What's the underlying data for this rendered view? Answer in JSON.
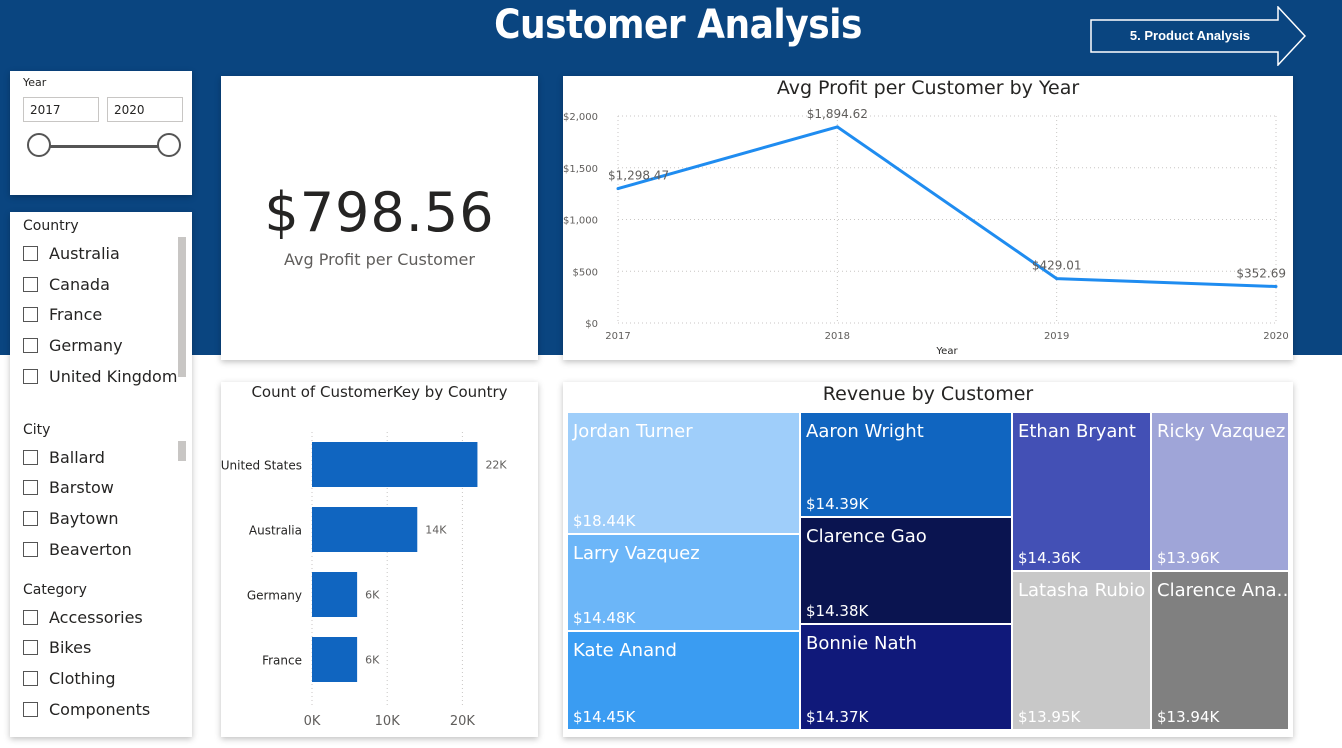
{
  "page": {
    "title": "Customer Analysis"
  },
  "nav_button": {
    "label": "5. Product Analysis"
  },
  "year_slicer": {
    "label": "Year",
    "start": "2017",
    "end": "2020"
  },
  "country_slicer": {
    "title": "Country",
    "items": [
      "Australia",
      "Canada",
      "France",
      "Germany",
      "United Kingdom"
    ]
  },
  "city_slicer": {
    "title": "City",
    "items": [
      "Ballard",
      "Barstow",
      "Baytown",
      "Beaverton"
    ]
  },
  "category_slicer": {
    "title": "Category",
    "items": [
      "Accessories",
      "Bikes",
      "Clothing",
      "Components"
    ]
  },
  "kpi": {
    "value": "$798.56",
    "label": "Avg Profit per Customer"
  },
  "line_chart": {
    "title": "Avg Profit per Customer by Year"
  },
  "bar_chart": {
    "title": "Count of CustomerKey by Country"
  },
  "treemap": {
    "title": "Revenue by Customer"
  },
  "colors": {
    "header": "#0a4580",
    "line": "#1f8cf0",
    "bar": "#1065c0"
  },
  "chart_data": [
    {
      "type": "line",
      "title": "Avg Profit per Customer by Year",
      "xlabel": "Year",
      "ylabel": "",
      "x": [
        "2017",
        "2018",
        "2019",
        "2020"
      ],
      "values": [
        1298.47,
        1894.62,
        429.01,
        352.69
      ],
      "data_labels": [
        "$1,298.47",
        "$1,894.62",
        "$429.01",
        "$352.69"
      ],
      "ylim": [
        0,
        2000
      ],
      "yticks": [
        "$0",
        "$500",
        "$1,000",
        "$1,500",
        "$2,000"
      ],
      "grid": true
    },
    {
      "type": "bar",
      "orientation": "horizontal",
      "title": "Count of CustomerKey by Country",
      "categories": [
        "United States",
        "Australia",
        "Germany",
        "France"
      ],
      "values": [
        22000,
        14000,
        6000,
        6000
      ],
      "data_labels": [
        "22K",
        "14K",
        "6K",
        "6K"
      ],
      "xlim": [
        0,
        25000
      ],
      "xticks": [
        "0K",
        "10K",
        "20K"
      ],
      "grid": true
    },
    {
      "type": "treemap",
      "title": "Revenue by Customer",
      "items": [
        {
          "name": "Jordan Turner",
          "label": "$18.44K",
          "value": 18440,
          "color": "#9fcefa",
          "text": "#ffffff"
        },
        {
          "name": "Larry Vazquez",
          "label": "$14.48K",
          "value": 14480,
          "color": "#6cb6f8",
          "text": "#ffffff"
        },
        {
          "name": "Kate Anand",
          "label": "$14.45K",
          "value": 14450,
          "color": "#3a9cf2",
          "text": "#ffffff"
        },
        {
          "name": "Aaron Wright",
          "label": "$14.39K",
          "value": 14390,
          "color": "#1065c0",
          "text": "#ffffff"
        },
        {
          "name": "Clarence Gao",
          "label": "$14.38K",
          "value": 14380,
          "color": "#0a1450",
          "text": "#ffffff"
        },
        {
          "name": "Bonnie Nath",
          "label": "$14.37K",
          "value": 14370,
          "color": "#10197a",
          "text": "#ffffff"
        },
        {
          "name": "Ethan Bryant",
          "label": "$14.36K",
          "value": 14360,
          "color": "#4350b5",
          "text": "#ffffff"
        },
        {
          "name": "Ricky Vazquez",
          "label": "$13.96K",
          "value": 13960,
          "color": "#9fa5d8",
          "text": "#ffffff"
        },
        {
          "name": "Latasha Rubio",
          "label": "$13.95K",
          "value": 13950,
          "color": "#c8c8c8",
          "text": "#ffffff"
        },
        {
          "name": "Clarence Ana…",
          "label": "$13.94K",
          "value": 13940,
          "color": "#808080",
          "text": "#ffffff"
        }
      ]
    }
  ]
}
